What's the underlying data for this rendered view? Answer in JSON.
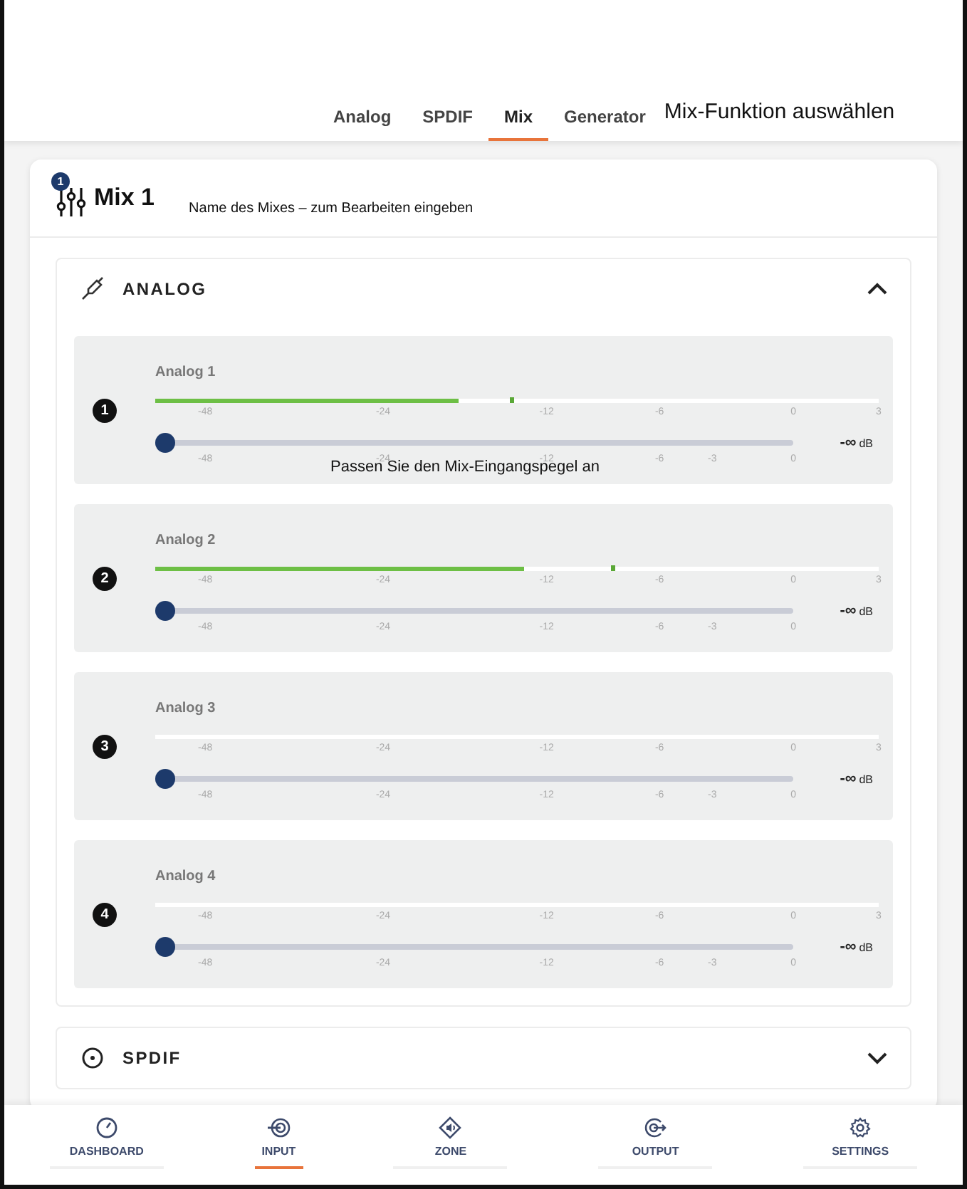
{
  "tabs": [
    {
      "label": "Analog",
      "selected": false
    },
    {
      "label": "SPDIF",
      "selected": false
    },
    {
      "label": "Mix",
      "selected": true
    },
    {
      "label": "Generator",
      "selected": false
    }
  ],
  "tabs_note": "Mix-Funktion auswählen",
  "mix": {
    "badge": "1",
    "title": "Mix 1",
    "note": "Name des Mixes – zum Bearbeiten eingeben"
  },
  "sections": [
    {
      "kind": "analog",
      "title": "ANALOG",
      "expanded": true,
      "channels": [
        {
          "number": "1",
          "name": "Analog 1",
          "meter": {
            "level": 0.42
          },
          "peak": {
            "level": 0.49
          },
          "meter_scale": [
            "-48",
            "-24",
            "-12",
            "-6",
            "0",
            "3"
          ],
          "fader": {
            "level": 0
          },
          "fader_scale": [
            "-48",
            "-24",
            "-12",
            "-6",
            "-3",
            "0"
          ],
          "reading": "-∞",
          "unit": "dB",
          "note": "Passen Sie den Mix-Eingangspegel an"
        },
        {
          "number": "2",
          "name": "Analog 2",
          "meter": {
            "level": 0.51
          },
          "peak": {
            "level": 0.63
          },
          "meter_scale": [
            "-48",
            "-24",
            "-12",
            "-6",
            "0",
            "3"
          ],
          "fader": {
            "level": 0
          },
          "fader_scale": [
            "-48",
            "-24",
            "-12",
            "-6",
            "-3",
            "0"
          ],
          "reading": "-∞",
          "unit": "dB"
        },
        {
          "number": "3",
          "name": "Analog 3",
          "meter_scale": [
            "-48",
            "-24",
            "-12",
            "-6",
            "0",
            "3"
          ],
          "fader": {
            "level": 0
          },
          "fader_scale": [
            "-48",
            "-24",
            "-12",
            "-6",
            "-3",
            "0"
          ],
          "reading": "-∞",
          "unit": "dB"
        },
        {
          "number": "4",
          "name": "Analog 4",
          "meter_scale": [
            "-48",
            "-24",
            "-12",
            "-6",
            "0",
            "3"
          ],
          "fader": {
            "level": 0
          },
          "fader_scale": [
            "-48",
            "-24",
            "-12",
            "-6",
            "-3",
            "0"
          ],
          "reading": "-∞",
          "unit": "dB"
        }
      ]
    },
    {
      "kind": "spdif",
      "title": "SPDIF",
      "expanded": false
    }
  ],
  "nav": [
    {
      "kind": "dashboard",
      "label": "DASHBOARD",
      "selected": false
    },
    {
      "kind": "input",
      "label": "INPUT",
      "selected": true
    },
    {
      "kind": "zone",
      "label": "ZONE",
      "selected": false
    },
    {
      "kind": "output",
      "label": "OUTPUT",
      "selected": false
    },
    {
      "kind": "settings",
      "label": "SETTINGS",
      "selected": false
    }
  ]
}
